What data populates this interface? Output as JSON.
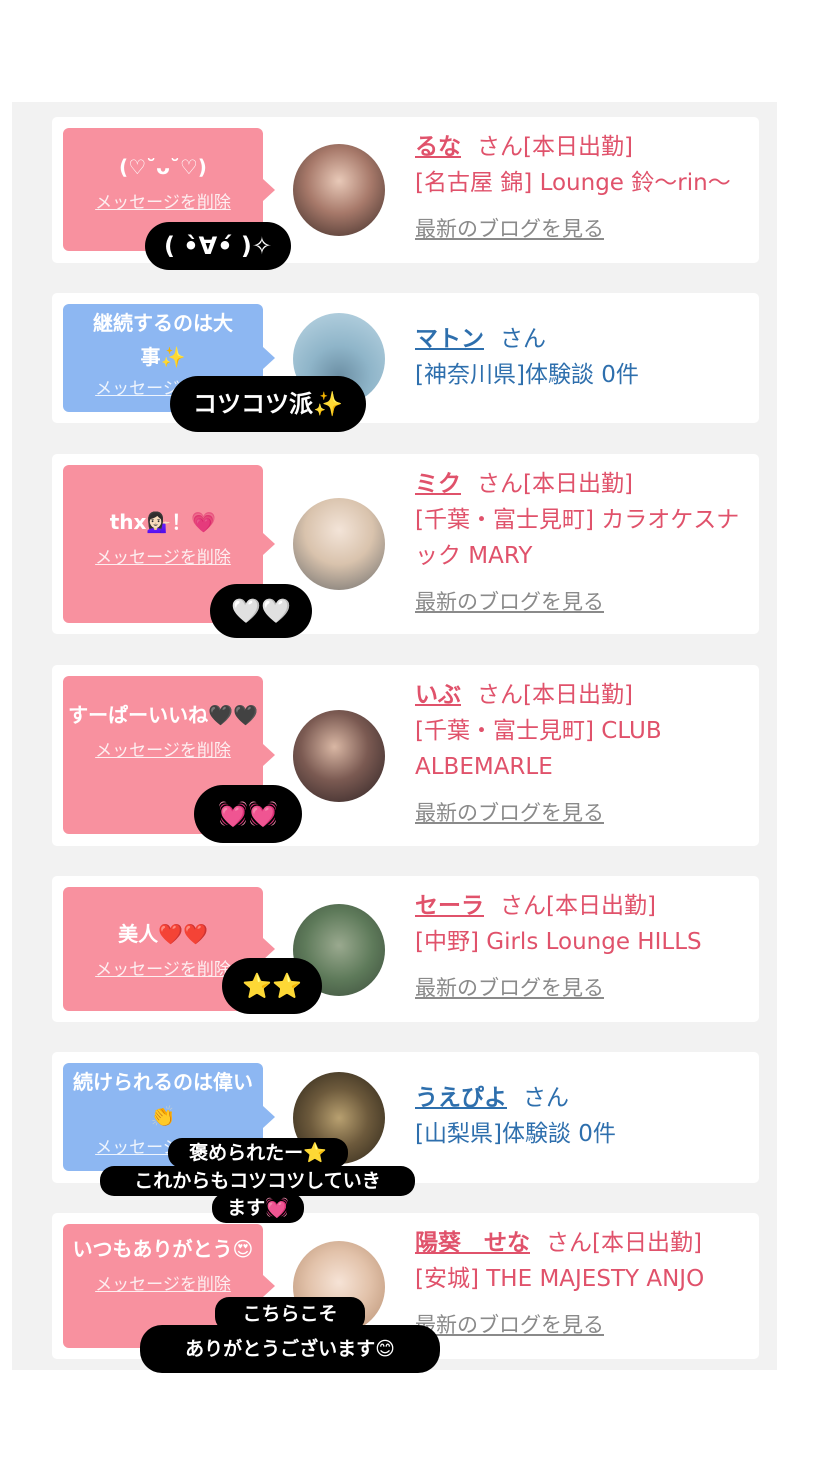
{
  "cards": [
    {
      "bubble_message": "(♡˘ᴗ˘♡)",
      "delete_label": "メッセージを削除",
      "name": "るな",
      "suffix": "さん[本日出勤]",
      "shop": "[名古屋 錦] Lounge 鈴〜rin〜",
      "blog": "最新のブログを見る",
      "sticker": "( •̀∀•́ )✧"
    },
    {
      "bubble_message": "継続するのは大事✨",
      "delete_label": "メッセージを削除",
      "name": "マトン",
      "suffix": "さん",
      "shop": "[神奈川県]体験談 0件",
      "sticker": "コツコツ派✨"
    },
    {
      "bubble_message": "thx💁🏻‍♀️！💗",
      "delete_label": "メッセージを削除",
      "name": "ミク",
      "suffix": "さん[本日出勤]",
      "shop": "[千葉・富士見町] カラオケスナック MARY",
      "blog": "最新のブログを見る",
      "sticker": "🤍🤍"
    },
    {
      "bubble_message": "すーぱーいいね🖤🖤",
      "delete_label": "メッセージを削除",
      "name": "いぶ",
      "suffix": "さん[本日出勤]",
      "shop": "[千葉・富士見町] CLUB ALBEMARLE",
      "blog": "最新のブログを見る",
      "sticker": "💓💓"
    },
    {
      "bubble_message": "美人❤️❤️",
      "delete_label": "メッセージを削除",
      "name": "セーラ",
      "suffix": "さん[本日出勤]",
      "shop": "[中野] Girls Lounge HILLS",
      "blog": "最新のブログを見る",
      "sticker": "⭐️⭐️"
    },
    {
      "bubble_message": "続けられるのは偉い👏",
      "delete_label": "メッセージを削除",
      "name": "うえぴよ",
      "suffix": "さん",
      "shop": "[山梨県]体験談 0件",
      "sticker_lines": [
        "褒められたー⭐️",
        "これからもコツコツしていき",
        "ます💓"
      ]
    },
    {
      "bubble_message": "いつもありがとう😍",
      "delete_label": "メッセージを削除",
      "name": "陽葵　せな",
      "suffix": "さん[本日出勤]",
      "shop": "[安城] THE MAJESTY ANJO",
      "blog": "最新のブログを見る",
      "sticker_lines": [
        "こちらこそ",
        "ありがとうございます😊"
      ]
    }
  ]
}
